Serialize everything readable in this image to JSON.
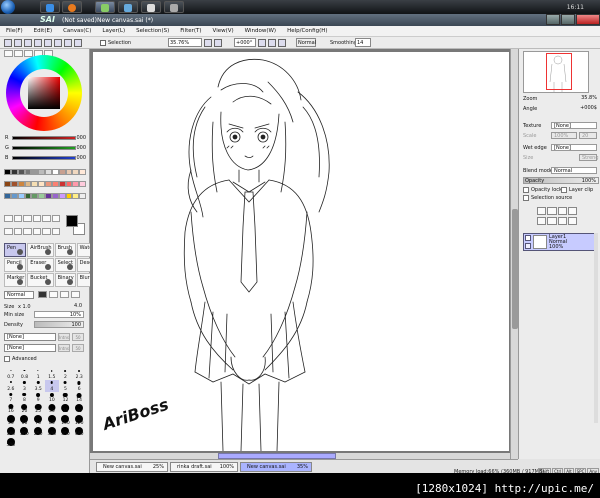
{
  "taskbar": {
    "buttons": [
      "ie",
      "firefox",
      "paint-tool",
      "explorer-1",
      "explorer-2",
      "explorer-3"
    ],
    "clock": "16:11"
  },
  "window": {
    "logo": "SAI",
    "title": "(Not saved)New canvas.sai (*)",
    "controls": {
      "minimize": "_",
      "maximize": "□",
      "close": "×"
    }
  },
  "menu": [
    "File(F)",
    "Edit(E)",
    "Canvas(C)",
    "Layer(L)",
    "Selection(S)",
    "Filter(T)",
    "View(V)",
    "Window(W)",
    "Help/Config(H)"
  ],
  "toolbar": {
    "selection_label": "Selection",
    "zoom": "35.76%",
    "rotation": "+000°",
    "blend": "Normal",
    "smoothing_label": "Smoothing",
    "smoothing_value": "14"
  },
  "color": {
    "sliders": [
      {
        "label": "R",
        "value": "000",
        "color": "#d02020"
      },
      {
        "label": "G",
        "value": "000",
        "color": "#20a020"
      },
      {
        "label": "B",
        "value": "000",
        "color": "#2040d0"
      }
    ],
    "swatches": [
      "#000000",
      "#333333",
      "#555555",
      "#777777",
      "#999999",
      "#bbbbbb",
      "#dddddd",
      "#ffffff",
      "#c8a090",
      "#e8c8b0",
      "#f0d8c0",
      "#ffe8d8",
      "#8b4513",
      "#a0522d",
      "#cd853f",
      "#deb887",
      "#f5deb3",
      "#ffe4c4",
      "#e9967a",
      "#fa8072",
      "#cc3333",
      "#ff6666",
      "#ff99aa",
      "#ffccdd",
      "#336699",
      "#6699cc",
      "#99ccff",
      "#336633",
      "#669966",
      "#99cc99",
      "#663399",
      "#9966cc",
      "#cc99ff",
      "#ffcc00",
      "#ffee88",
      "#eeeeee"
    ]
  },
  "brush_tools": [
    {
      "label": "Pen",
      "selected": true
    },
    {
      "label": "AirBrush",
      "selected": false
    },
    {
      "label": "Brush",
      "selected": false
    },
    {
      "label": "Water",
      "selected": false
    },
    {
      "label": "Pencil",
      "selected": false
    },
    {
      "label": "Eraser",
      "selected": false
    },
    {
      "label": "Select",
      "selected": false
    },
    {
      "label": "Deselect",
      "selected": false
    },
    {
      "label": "Marker",
      "selected": false
    },
    {
      "label": "Bucket",
      "selected": false
    },
    {
      "label": "Binary",
      "selected": false
    },
    {
      "label": "Blur",
      "selected": false
    }
  ],
  "brush_props": {
    "mode": "Normal",
    "size_label": "Size",
    "size_multiplier": "x 1.0",
    "size_value": "4.0",
    "min_size_label": "Min size",
    "min_size_value": "10%",
    "density_label": "Density",
    "density_value": "100",
    "texture_1": "[None]",
    "texture_2": "[None]",
    "side_1a": "Intns",
    "side_1b": "50",
    "side_2a": "Intns",
    "side_2b": "50",
    "advanced_label": "Advanced"
  },
  "brush_sizes": [
    "0.7",
    "0.8",
    "1",
    "1.5",
    "2",
    "2.3",
    "2.6",
    "3",
    "3.5",
    "4",
    "5",
    "6",
    "7",
    "8",
    "9",
    "10",
    "12",
    "14",
    "16",
    "20",
    "25",
    "30",
    "35",
    "40",
    "50",
    "60",
    "70",
    "80",
    "100",
    "120",
    "160",
    "200",
    "250",
    "300",
    "350",
    "400",
    "500"
  ],
  "tabs": [
    {
      "name": "New canvas.sai",
      "pct": "25%",
      "active": false
    },
    {
      "name": "rinka draft.sai",
      "pct": "100%",
      "active": false
    },
    {
      "name": "New canvas.sai",
      "pct": "35%",
      "active": true
    }
  ],
  "status": {
    "memory": "Memory load:66% (360MB / 917MB)",
    "indicators": [
      "Shift",
      "Ctrl",
      "Alt",
      "SPC",
      "Any"
    ]
  },
  "right": {
    "zoom_label": "Zoom",
    "zoom_value": "35.8%",
    "angle_label": "Angle",
    "angle_value": "+000$",
    "texture_label": "Texture",
    "texture_value": "[None]",
    "scale_label": "Scale",
    "scale_value": "100%",
    "scale_b": "20",
    "wet_edge_label": "Wet edge",
    "wet_edge_value": "[None]",
    "size_label": "Size",
    "size_b": "Streng",
    "blend_label": "Blend mode",
    "blend_value": "Normal",
    "opacity_label": "Opacity",
    "opacity_value": "100%",
    "opacity_lock": "Opacity lock",
    "layer_clip": "Layer clip",
    "selection_source": "Selection source"
  },
  "layers": [
    {
      "name": "Layer1",
      "mode": "Normal",
      "opacity": "100%"
    }
  ],
  "signature": "AriBoss",
  "watermark": "[1280x1024]  http://upic.me/"
}
